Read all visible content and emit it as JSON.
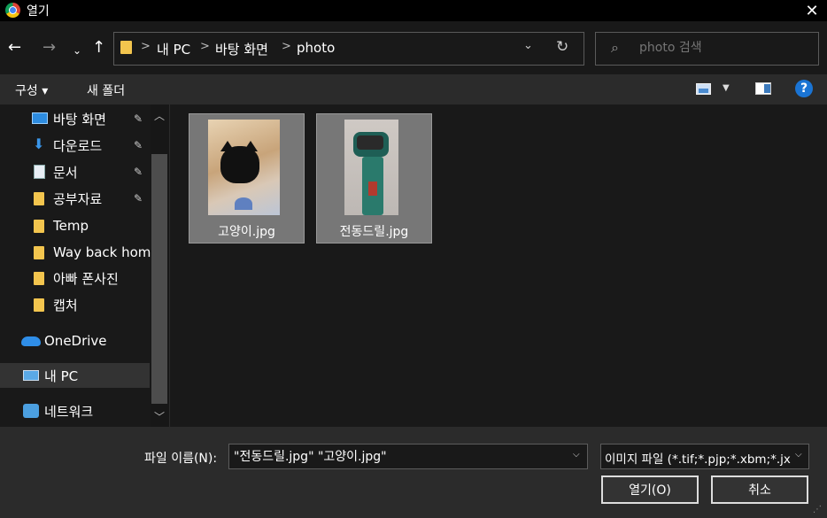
{
  "window": {
    "title": "열기",
    "close_glyph": "✕"
  },
  "nav": {
    "back_glyph": "←",
    "forward_glyph": "→",
    "recent_glyph": "⌄",
    "up_glyph": "↑"
  },
  "address": {
    "crumbs": [
      "내 PC",
      "바탕 화면",
      "photo"
    ],
    "separator": ">",
    "dropdown_glyph": "⌄",
    "refresh_glyph": "↻"
  },
  "search": {
    "placeholder": "photo 검색",
    "icon": "search-icon"
  },
  "toolbar": {
    "organize_label": "구성 ▾",
    "new_folder_label": "새 폴더",
    "view_dropdown_glyph": "▼",
    "help_label": "?"
  },
  "sidebar": {
    "items": [
      {
        "label": "바탕 화면",
        "icon": "desktop-icon",
        "pinned": true
      },
      {
        "label": "다운로드",
        "icon": "download-icon",
        "pinned": true
      },
      {
        "label": "문서",
        "icon": "document-icon",
        "pinned": true
      },
      {
        "label": "공부자료",
        "icon": "folder-icon",
        "pinned": true
      },
      {
        "label": "Temp",
        "icon": "folder-icon",
        "pinned": false
      },
      {
        "label": "Way back home",
        "icon": "folder-icon",
        "pinned": false
      },
      {
        "label": "아빠 폰사진",
        "icon": "folder-icon",
        "pinned": false
      },
      {
        "label": "캡처",
        "icon": "folder-icon",
        "pinned": false
      },
      {
        "label": "OneDrive",
        "icon": "onedrive-icon",
        "pinned": false
      },
      {
        "label": "내 PC",
        "icon": "pc-icon",
        "pinned": false,
        "selected": true
      },
      {
        "label": "네트워크",
        "icon": "network-icon",
        "pinned": false
      }
    ],
    "pin_glyph": "📌",
    "scroll_up_glyph": "︿",
    "scroll_down_glyph": "﹀"
  },
  "files": [
    {
      "name": "고양이.jpg",
      "selected": true
    },
    {
      "name": "전동드릴.jpg",
      "selected": true
    }
  ],
  "bottom": {
    "filename_label": "파일 이름(N):",
    "filename_value": "\"전동드릴.jpg\" \"고양이.jpg\"",
    "filetype_label": "이미지 파일 (*.tif;*.pjp;*.xbm;*.jx",
    "open_label": "열기(O)",
    "cancel_label": "취소",
    "dropdown_glyph": "⌵"
  },
  "colors": {
    "background": "#191919",
    "toolbar": "#2b2b2b",
    "selection": "#777777",
    "folder": "#f3c54e",
    "accent": "#1a74d4"
  }
}
